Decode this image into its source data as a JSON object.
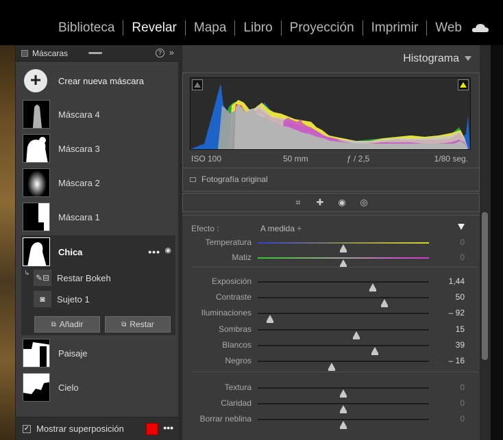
{
  "modules": [
    "Biblioteca",
    "Revelar",
    "Mapa",
    "Libro",
    "Proyección",
    "Imprimir",
    "Web"
  ],
  "active_module": "Revelar",
  "masks_panel": {
    "title": "Máscaras",
    "help": "?",
    "collapse": "»",
    "create_label": "Crear nueva máscara",
    "masks": [
      "Máscara 4",
      "Máscara 3",
      "Máscara 2",
      "Máscara 1"
    ],
    "selected": {
      "name": "Chica",
      "more": "•••",
      "eye": "◉",
      "components": [
        {
          "label": "Restar Bokeh",
          "icon": "brush-subtract-icon"
        },
        {
          "label": "Sujeto 1",
          "icon": "person-icon"
        }
      ],
      "add_label": "Añadir",
      "subtract_label": "Restar"
    },
    "other_masks": [
      "Paisaje",
      "Cielo"
    ],
    "overlay_label": "Mostrar superposición",
    "overlay_color": "#e00000",
    "more": "•••"
  },
  "histogram": {
    "title": "Histograma",
    "iso": "ISO 100",
    "focal": "50 mm",
    "aperture": "ƒ / 2,5",
    "shutter": "1/80 seg.",
    "original_label": "Fotografía original"
  },
  "adjust": {
    "effect_label": "Efecto :",
    "effect_value": "A medida ÷",
    "sliders": [
      {
        "label": "Temperatura",
        "value": "0",
        "pos": 0.5,
        "bright": false,
        "track": "temp"
      },
      {
        "label": "Matiz",
        "value": "0",
        "pos": 0.5,
        "bright": false,
        "track": "tint"
      },
      {
        "label": "Exposición",
        "value": "1,44",
        "pos": 0.67,
        "bright": true
      },
      {
        "label": "Contraste",
        "value": "50",
        "pos": 0.74,
        "bright": true
      },
      {
        "label": "Iluminaciones",
        "value": "– 92",
        "pos": 0.07,
        "bright": true
      },
      {
        "label": "Sombras",
        "value": "15",
        "pos": 0.575,
        "bright": true
      },
      {
        "label": "Blancos",
        "value": "39",
        "pos": 0.685,
        "bright": true
      },
      {
        "label": "Negros",
        "value": "– 16",
        "pos": 0.43,
        "bright": true
      },
      {
        "label": "Textura",
        "value": "0",
        "pos": 0.5,
        "bright": false
      },
      {
        "label": "Claridad",
        "value": "0",
        "pos": 0.5,
        "bright": false
      },
      {
        "label": "Borrar neblina",
        "value": "0",
        "pos": 0.5,
        "bright": false
      }
    ]
  }
}
